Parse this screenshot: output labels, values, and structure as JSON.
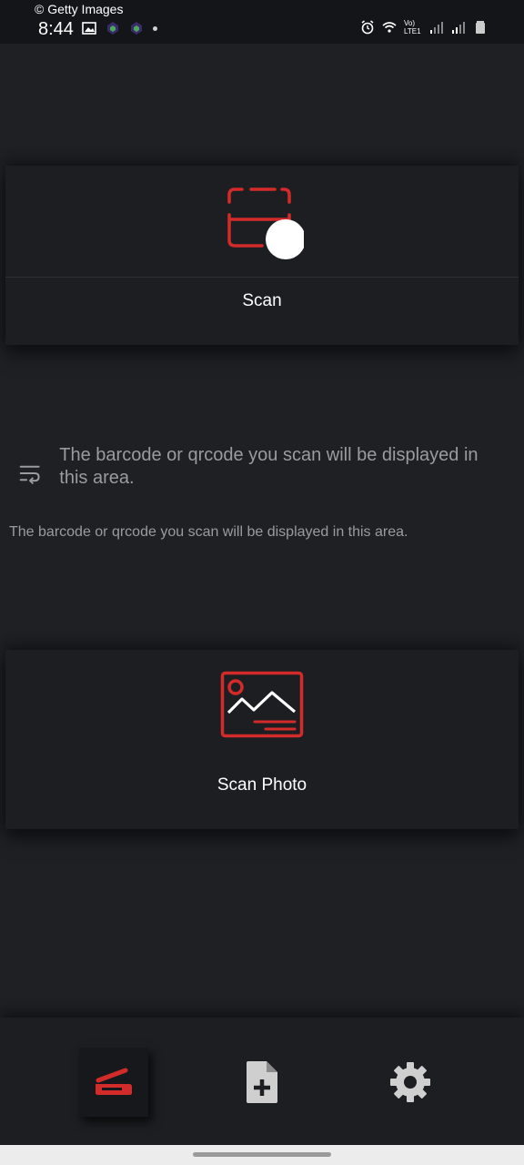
{
  "status_bar": {
    "watermark": "© Getty Images",
    "time": "8:44",
    "network_label": "Vo) LTE1"
  },
  "scan_card": {
    "label": "Scan",
    "icon": "scan-frame-icon"
  },
  "result": {
    "message_large": "The barcode or qrcode you scan will be displayed in this area.",
    "message_small": "The barcode or qrcode you scan will be displayed in this area.",
    "icon": "text-wrap-icon"
  },
  "photo_card": {
    "label": "Scan Photo",
    "icon": "image-icon"
  },
  "bottom_nav": {
    "items": [
      {
        "icon": "scanner-icon",
        "selected": true
      },
      {
        "icon": "new-document-icon",
        "selected": false
      },
      {
        "icon": "gear-icon",
        "selected": false
      }
    ]
  },
  "colors": {
    "background": "#1f2024",
    "card": "#1d1e22",
    "accent": "#d32a2a",
    "muted_text": "#9a9aa0",
    "icon_grey": "#cfcfcf"
  }
}
